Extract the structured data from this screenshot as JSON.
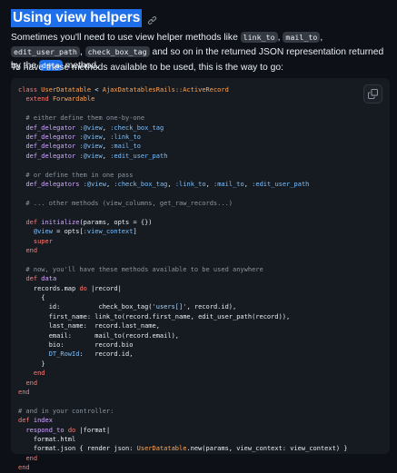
{
  "heading": {
    "title": "Using view helpers"
  },
  "para1": {
    "t1": "Sometimes you'll need to use view helper methods like ",
    "c1": "link_to",
    "t2": ", ",
    "c2": "mail_to",
    "t3": ", ",
    "c3": "edit_user_path",
    "t4": ", ",
    "c4": "check_box_tag",
    "t5": " and so on in the returned JSON representation returned by the ",
    "c5": "data",
    "t6": " method."
  },
  "para2": {
    "text": "To have these methods available to be used, this is the way to go:"
  },
  "code": {
    "lines": [
      [
        [
          "k",
          "class "
        ],
        [
          "e",
          "UserDatatable"
        ],
        [
          "t",
          " < "
        ],
        [
          "e",
          "AjaxDatatablesRails::ActiveRecord"
        ]
      ],
      [
        [
          "t",
          "  "
        ],
        [
          "k",
          "extend "
        ],
        [
          "e",
          "Forwardable"
        ]
      ],
      [
        [
          "t",
          ""
        ]
      ],
      [
        [
          "c",
          "  # either define them one-by-one"
        ]
      ],
      [
        [
          "t",
          "  "
        ],
        [
          "f",
          "def_delegator "
        ],
        [
          "v",
          ":@view"
        ],
        [
          "t",
          ", "
        ],
        [
          "v",
          ":check_box_tag"
        ]
      ],
      [
        [
          "t",
          "  "
        ],
        [
          "f",
          "def_delegator "
        ],
        [
          "v",
          ":@view"
        ],
        [
          "t",
          ", "
        ],
        [
          "v",
          ":link_to"
        ]
      ],
      [
        [
          "t",
          "  "
        ],
        [
          "f",
          "def_delegator "
        ],
        [
          "v",
          ":@view"
        ],
        [
          "t",
          ", "
        ],
        [
          "v",
          ":mail_to"
        ]
      ],
      [
        [
          "t",
          "  "
        ],
        [
          "f",
          "def_delegator "
        ],
        [
          "v",
          ":@view"
        ],
        [
          "t",
          ", "
        ],
        [
          "v",
          ":edit_user_path"
        ]
      ],
      [
        [
          "t",
          ""
        ]
      ],
      [
        [
          "c",
          "  # or define them in one pass"
        ]
      ],
      [
        [
          "t",
          "  "
        ],
        [
          "f",
          "def_delegators "
        ],
        [
          "v",
          ":@view"
        ],
        [
          "t",
          ", "
        ],
        [
          "v",
          ":check_box_tag"
        ],
        [
          "t",
          ", "
        ],
        [
          "v",
          ":link_to"
        ],
        [
          "t",
          ", "
        ],
        [
          "v",
          ":mail_to"
        ],
        [
          "t",
          ", "
        ],
        [
          "v",
          ":edit_user_path"
        ]
      ],
      [
        [
          "t",
          ""
        ]
      ],
      [
        [
          "c",
          "  # ... other methods (view_columns, get_raw_records...)"
        ]
      ],
      [
        [
          "t",
          ""
        ]
      ],
      [
        [
          "t",
          "  "
        ],
        [
          "k",
          "def "
        ],
        [
          "f",
          "initialize"
        ],
        [
          "t",
          "(params, opts = {})"
        ]
      ],
      [
        [
          "t",
          "    "
        ],
        [
          "v",
          "@view"
        ],
        [
          "t",
          " = opts["
        ],
        [
          "v",
          ":view_context"
        ],
        [
          "t",
          "]"
        ]
      ],
      [
        [
          "t",
          "    "
        ],
        [
          "k",
          "super"
        ]
      ],
      [
        [
          "t",
          "  "
        ],
        [
          "k",
          "end"
        ]
      ],
      [
        [
          "t",
          ""
        ]
      ],
      [
        [
          "c",
          "  # now, you'll have these methods available to be used anywhere"
        ]
      ],
      [
        [
          "t",
          "  "
        ],
        [
          "k",
          "def "
        ],
        [
          "f",
          "data"
        ]
      ],
      [
        [
          "t",
          "    records.map "
        ],
        [
          "k",
          "do"
        ],
        [
          "t",
          " |record|"
        ]
      ],
      [
        [
          "t",
          "      {"
        ]
      ],
      [
        [
          "t",
          "        id:          check_box_tag("
        ],
        [
          "s",
          "'users[]'"
        ],
        [
          "t",
          ", record.id),"
        ]
      ],
      [
        [
          "t",
          "        first_name: link_to(record.first_name, edit_user_path(record)),"
        ]
      ],
      [
        [
          "t",
          "        last_name:  record.last_name,"
        ]
      ],
      [
        [
          "t",
          "        email:      mail_to(record.email),"
        ]
      ],
      [
        [
          "t",
          "        bio:        record.bio"
        ]
      ],
      [
        [
          "t",
          "        "
        ],
        [
          "v",
          "DT_RowId"
        ],
        [
          "t",
          ":   record.id,"
        ]
      ],
      [
        [
          "t",
          "      }"
        ]
      ],
      [
        [
          "t",
          "    "
        ],
        [
          "k",
          "end"
        ]
      ],
      [
        [
          "t",
          "  "
        ],
        [
          "k",
          "end"
        ]
      ],
      [
        [
          "k",
          "end"
        ]
      ],
      [
        [
          "t",
          ""
        ]
      ],
      [
        [
          "c",
          "# and in your controller:"
        ]
      ],
      [
        [
          "k",
          "def "
        ],
        [
          "f",
          "index"
        ]
      ],
      [
        [
          "t",
          "  "
        ],
        [
          "f",
          "respond_to"
        ],
        [
          "t",
          " "
        ],
        [
          "k",
          "do"
        ],
        [
          "t",
          " |format|"
        ]
      ],
      [
        [
          "t",
          "    format.html"
        ]
      ],
      [
        [
          "t",
          "    format.json { render json: "
        ],
        [
          "e",
          "UserDatatable"
        ],
        [
          "t",
          ".new(params, view_context: view_context) }"
        ]
      ],
      [
        [
          "t",
          "  "
        ],
        [
          "k",
          "end"
        ]
      ],
      [
        [
          "k",
          "end"
        ]
      ]
    ]
  },
  "colors": {
    "background": "#0d1117",
    "code_background": "#161b22",
    "accent": "#1f6feb",
    "keyword": "#ff7b72",
    "function": "#d2a8ff",
    "comment": "#8b949e",
    "string": "#a5d6ff",
    "class": "#ffa657",
    "symbol": "#79c0ff"
  },
  "icons": {
    "anchor": "link-icon",
    "copy": "copy-icon"
  }
}
